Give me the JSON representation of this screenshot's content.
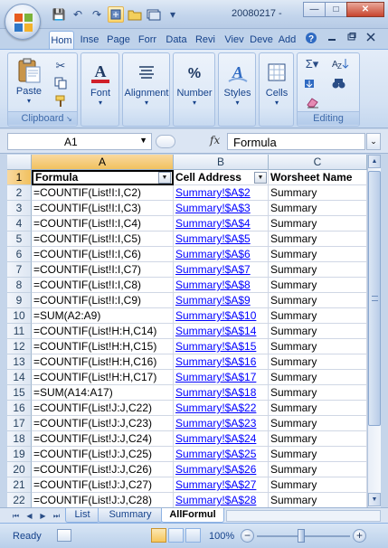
{
  "window": {
    "title": "20080217 -",
    "minimize_label": "—",
    "maximize_label": "□",
    "close_label": "✕"
  },
  "quick_access": {
    "save_icon": "💾",
    "undo_icon": "↶",
    "redo_icon": "↷",
    "customize_icon": "▾"
  },
  "tabs": [
    {
      "label": "Hom",
      "active": true
    },
    {
      "label": "Inse"
    },
    {
      "label": "Page"
    },
    {
      "label": "Forr"
    },
    {
      "label": "Data"
    },
    {
      "label": "Revi"
    },
    {
      "label": "Viev"
    },
    {
      "label": "Deve"
    },
    {
      "label": "Add"
    }
  ],
  "ribbon": {
    "clipboard": {
      "paste": "Paste",
      "group": "Clipboard"
    },
    "font": {
      "label": "Font"
    },
    "alignment": {
      "label": "Alignment"
    },
    "number": {
      "label": "Number"
    },
    "styles": {
      "label": "Styles"
    },
    "cells": {
      "label": "Cells"
    },
    "editing": {
      "group": "Editing"
    }
  },
  "formula_bar": {
    "name_box": "A1",
    "fx_label": "fx",
    "content": "Formula"
  },
  "columns": [
    "A",
    "B",
    "C"
  ],
  "header_row": {
    "row": "1",
    "a": "Formula",
    "b": "Cell Address",
    "c": "Worsheet Name"
  },
  "rows": [
    {
      "row": "2",
      "a": "=COUNTIF(List!I:I,C2)",
      "b": "Summary!$A$2",
      "c": "Summary"
    },
    {
      "row": "3",
      "a": "=COUNTIF(List!I:I,C3)",
      "b": "Summary!$A$3",
      "c": "Summary"
    },
    {
      "row": "4",
      "a": "=COUNTIF(List!I:I,C4)",
      "b": "Summary!$A$4",
      "c": "Summary"
    },
    {
      "row": "5",
      "a": "=COUNTIF(List!I:I,C5)",
      "b": "Summary!$A$5",
      "c": "Summary"
    },
    {
      "row": "6",
      "a": "=COUNTIF(List!I:I,C6)",
      "b": "Summary!$A$6",
      "c": "Summary"
    },
    {
      "row": "7",
      "a": "=COUNTIF(List!I:I,C7)",
      "b": "Summary!$A$7",
      "c": "Summary"
    },
    {
      "row": "8",
      "a": "=COUNTIF(List!I:I,C8)",
      "b": "Summary!$A$8",
      "c": "Summary"
    },
    {
      "row": "9",
      "a": "=COUNTIF(List!I:I,C9)",
      "b": "Summary!$A$9",
      "c": "Summary"
    },
    {
      "row": "10",
      "a": "=SUM(A2:A9)",
      "b": "Summary!$A$10",
      "c": "Summary"
    },
    {
      "row": "11",
      "a": "=COUNTIF(List!H:H,C14)",
      "b": "Summary!$A$14",
      "c": "Summary"
    },
    {
      "row": "12",
      "a": "=COUNTIF(List!H:H,C15)",
      "b": "Summary!$A$15",
      "c": "Summary"
    },
    {
      "row": "13",
      "a": "=COUNTIF(List!H:H,C16)",
      "b": "Summary!$A$16",
      "c": "Summary"
    },
    {
      "row": "14",
      "a": "=COUNTIF(List!H:H,C17)",
      "b": "Summary!$A$17",
      "c": "Summary"
    },
    {
      "row": "15",
      "a": "=SUM(A14:A17)",
      "b": "Summary!$A$18",
      "c": "Summary"
    },
    {
      "row": "16",
      "a": "=COUNTIF(List!J:J,C22)",
      "b": "Summary!$A$22",
      "c": "Summary"
    },
    {
      "row": "17",
      "a": "=COUNTIF(List!J:J,C23)",
      "b": "Summary!$A$23",
      "c": "Summary"
    },
    {
      "row": "18",
      "a": "=COUNTIF(List!J:J,C24)",
      "b": "Summary!$A$24",
      "c": "Summary"
    },
    {
      "row": "19",
      "a": "=COUNTIF(List!J:J,C25)",
      "b": "Summary!$A$25",
      "c": "Summary"
    },
    {
      "row": "20",
      "a": "=COUNTIF(List!J:J,C26)",
      "b": "Summary!$A$26",
      "c": "Summary"
    },
    {
      "row": "21",
      "a": "=COUNTIF(List!J:J,C27)",
      "b": "Summary!$A$27",
      "c": "Summary"
    },
    {
      "row": "22",
      "a": "=COUNTIF(List!J:J,C28)",
      "b": "Summary!$A$28",
      "c": "Summary"
    }
  ],
  "sheets": [
    {
      "label": "List"
    },
    {
      "label": "Summary"
    },
    {
      "label": "AllFormul",
      "active": true
    }
  ],
  "status": {
    "ready": "Ready",
    "zoom": "100%",
    "zoom_minus": "−",
    "zoom_plus": "+"
  }
}
